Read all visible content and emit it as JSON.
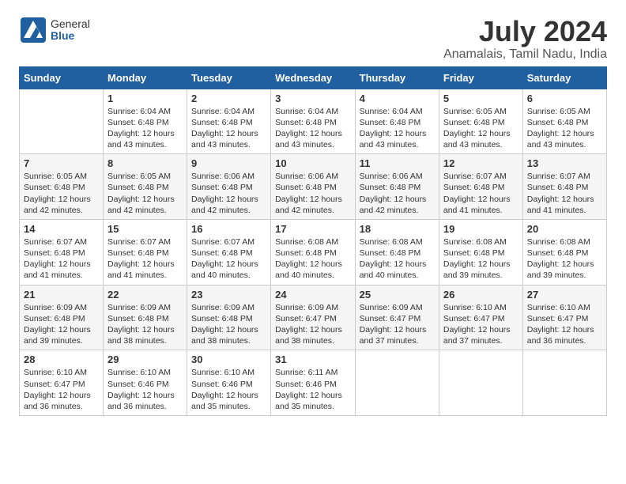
{
  "logo": {
    "general": "General",
    "blue": "Blue"
  },
  "title": "July 2024",
  "subtitle": "Anamalais, Tamil Nadu, India",
  "days_header": [
    "Sunday",
    "Monday",
    "Tuesday",
    "Wednesday",
    "Thursday",
    "Friday",
    "Saturday"
  ],
  "weeks": [
    [
      {
        "day": "",
        "info": ""
      },
      {
        "day": "1",
        "info": "Sunrise: 6:04 AM\nSunset: 6:48 PM\nDaylight: 12 hours\nand 43 minutes."
      },
      {
        "day": "2",
        "info": "Sunrise: 6:04 AM\nSunset: 6:48 PM\nDaylight: 12 hours\nand 43 minutes."
      },
      {
        "day": "3",
        "info": "Sunrise: 6:04 AM\nSunset: 6:48 PM\nDaylight: 12 hours\nand 43 minutes."
      },
      {
        "day": "4",
        "info": "Sunrise: 6:04 AM\nSunset: 6:48 PM\nDaylight: 12 hours\nand 43 minutes."
      },
      {
        "day": "5",
        "info": "Sunrise: 6:05 AM\nSunset: 6:48 PM\nDaylight: 12 hours\nand 43 minutes."
      },
      {
        "day": "6",
        "info": "Sunrise: 6:05 AM\nSunset: 6:48 PM\nDaylight: 12 hours\nand 43 minutes."
      }
    ],
    [
      {
        "day": "7",
        "info": "Sunrise: 6:05 AM\nSunset: 6:48 PM\nDaylight: 12 hours\nand 42 minutes."
      },
      {
        "day": "8",
        "info": "Sunrise: 6:05 AM\nSunset: 6:48 PM\nDaylight: 12 hours\nand 42 minutes."
      },
      {
        "day": "9",
        "info": "Sunrise: 6:06 AM\nSunset: 6:48 PM\nDaylight: 12 hours\nand 42 minutes."
      },
      {
        "day": "10",
        "info": "Sunrise: 6:06 AM\nSunset: 6:48 PM\nDaylight: 12 hours\nand 42 minutes."
      },
      {
        "day": "11",
        "info": "Sunrise: 6:06 AM\nSunset: 6:48 PM\nDaylight: 12 hours\nand 42 minutes."
      },
      {
        "day": "12",
        "info": "Sunrise: 6:07 AM\nSunset: 6:48 PM\nDaylight: 12 hours\nand 41 minutes."
      },
      {
        "day": "13",
        "info": "Sunrise: 6:07 AM\nSunset: 6:48 PM\nDaylight: 12 hours\nand 41 minutes."
      }
    ],
    [
      {
        "day": "14",
        "info": "Sunrise: 6:07 AM\nSunset: 6:48 PM\nDaylight: 12 hours\nand 41 minutes."
      },
      {
        "day": "15",
        "info": "Sunrise: 6:07 AM\nSunset: 6:48 PM\nDaylight: 12 hours\nand 41 minutes."
      },
      {
        "day": "16",
        "info": "Sunrise: 6:07 AM\nSunset: 6:48 PM\nDaylight: 12 hours\nand 40 minutes."
      },
      {
        "day": "17",
        "info": "Sunrise: 6:08 AM\nSunset: 6:48 PM\nDaylight: 12 hours\nand 40 minutes."
      },
      {
        "day": "18",
        "info": "Sunrise: 6:08 AM\nSunset: 6:48 PM\nDaylight: 12 hours\nand 40 minutes."
      },
      {
        "day": "19",
        "info": "Sunrise: 6:08 AM\nSunset: 6:48 PM\nDaylight: 12 hours\nand 39 minutes."
      },
      {
        "day": "20",
        "info": "Sunrise: 6:08 AM\nSunset: 6:48 PM\nDaylight: 12 hours\nand 39 minutes."
      }
    ],
    [
      {
        "day": "21",
        "info": "Sunrise: 6:09 AM\nSunset: 6:48 PM\nDaylight: 12 hours\nand 39 minutes."
      },
      {
        "day": "22",
        "info": "Sunrise: 6:09 AM\nSunset: 6:48 PM\nDaylight: 12 hours\nand 38 minutes."
      },
      {
        "day": "23",
        "info": "Sunrise: 6:09 AM\nSunset: 6:48 PM\nDaylight: 12 hours\nand 38 minutes."
      },
      {
        "day": "24",
        "info": "Sunrise: 6:09 AM\nSunset: 6:47 PM\nDaylight: 12 hours\nand 38 minutes."
      },
      {
        "day": "25",
        "info": "Sunrise: 6:09 AM\nSunset: 6:47 PM\nDaylight: 12 hours\nand 37 minutes."
      },
      {
        "day": "26",
        "info": "Sunrise: 6:10 AM\nSunset: 6:47 PM\nDaylight: 12 hours\nand 37 minutes."
      },
      {
        "day": "27",
        "info": "Sunrise: 6:10 AM\nSunset: 6:47 PM\nDaylight: 12 hours\nand 36 minutes."
      }
    ],
    [
      {
        "day": "28",
        "info": "Sunrise: 6:10 AM\nSunset: 6:47 PM\nDaylight: 12 hours\nand 36 minutes."
      },
      {
        "day": "29",
        "info": "Sunrise: 6:10 AM\nSunset: 6:46 PM\nDaylight: 12 hours\nand 36 minutes."
      },
      {
        "day": "30",
        "info": "Sunrise: 6:10 AM\nSunset: 6:46 PM\nDaylight: 12 hours\nand 35 minutes."
      },
      {
        "day": "31",
        "info": "Sunrise: 6:11 AM\nSunset: 6:46 PM\nDaylight: 12 hours\nand 35 minutes."
      },
      {
        "day": "",
        "info": ""
      },
      {
        "day": "",
        "info": ""
      },
      {
        "day": "",
        "info": ""
      }
    ]
  ]
}
